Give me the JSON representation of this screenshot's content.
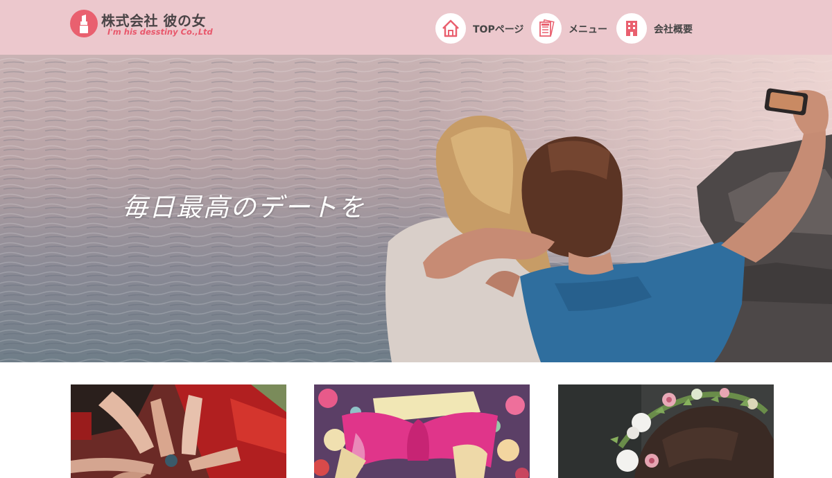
{
  "header": {
    "brand": {
      "name": "株式会社 彼の女",
      "tagline": "I'm his desstiny Co.,Ltd",
      "logo_icon": "lipstick-icon"
    },
    "nav": [
      {
        "label": "TOPページ",
        "icon": "home-icon"
      },
      {
        "label": "メニュー",
        "icon": "menu-document-icon"
      },
      {
        "label": "会社概要",
        "icon": "building-icon"
      }
    ]
  },
  "hero": {
    "catchphrase": "毎日最高のデートを",
    "image": "two-women-taking-selfie-by-the-sea"
  },
  "cards": [
    {
      "image": "hands-with-painted-nails-over-red-dresses"
    },
    {
      "image": "pink-kimono-obi-bow"
    },
    {
      "image": "flower-crown-on-hair"
    }
  ],
  "colors": {
    "header_bg": "#ecc8cd",
    "accent": "#e9606f",
    "nav_text": "#444444"
  }
}
